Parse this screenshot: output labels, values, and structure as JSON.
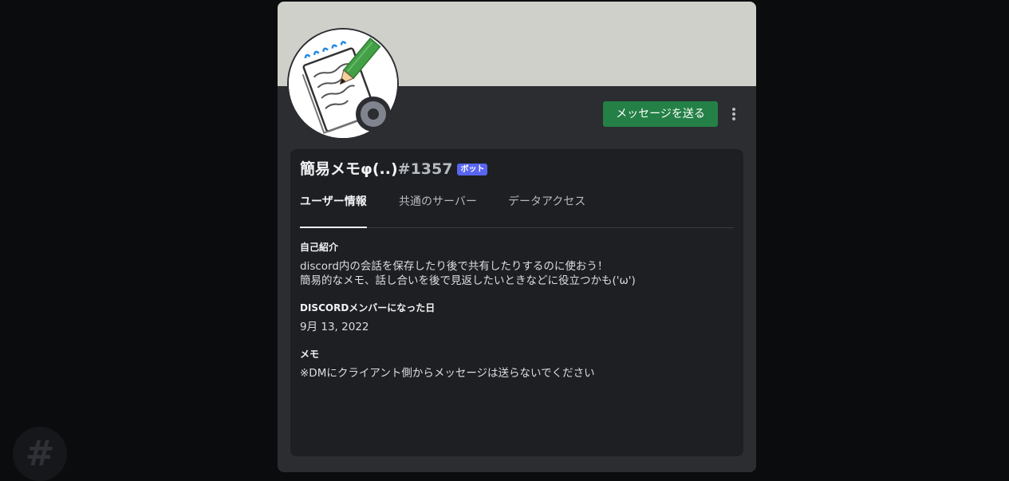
{
  "background": {
    "channel_icon_glyph": "#"
  },
  "profile": {
    "username": "簡易メモφ(..)",
    "discriminator": "#1357",
    "bot_tag": "ボット",
    "banner_color": "#d0d0cb",
    "status": "offline",
    "avatar_icon": "notepad-pencil-icon",
    "actions": {
      "send_message_label": "メッセージを送る",
      "more_icon": "more-vertical-icon"
    },
    "tabs": [
      {
        "label": "ユーザー情報",
        "active": true
      },
      {
        "label": "共通のサーバー",
        "active": false
      },
      {
        "label": "データアクセス",
        "active": false
      }
    ],
    "about": {
      "heading": "自己紹介",
      "line1": "discord内の会話を保存したり後で共有したりするのに使おう！",
      "line2": "簡易的なメモ、話し合いを後で見返したいときなどに役立つかも('ω')"
    },
    "member_since": {
      "heading": "DISCORDメンバーになった日",
      "date": "9月 13, 2022"
    },
    "note": {
      "heading": "メモ",
      "text": "※DMにクライアント側からメッセージは送らないでください"
    }
  },
  "colors": {
    "accent_green": "#248046",
    "bot_tag_blue": "#5865f2",
    "modal_bg": "#2b2d31",
    "card_bg": "#1e1f22"
  }
}
